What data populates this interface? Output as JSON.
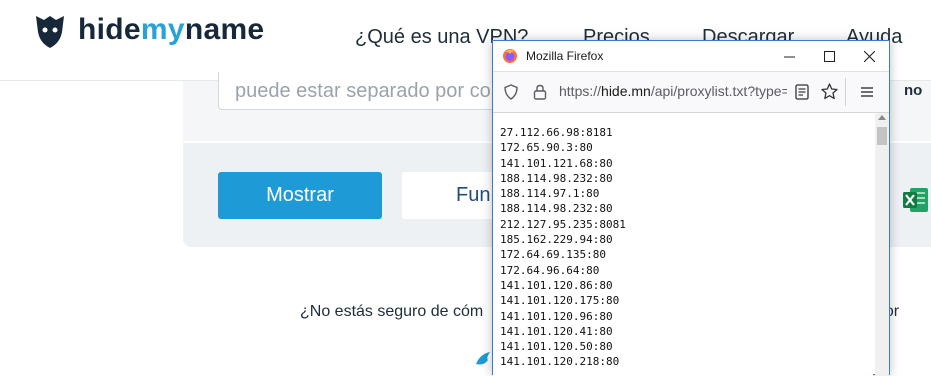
{
  "site": {
    "logo_prefix": "hide",
    "logo_accent": "my",
    "logo_suffix": "name",
    "nav": [
      "¿Qué es una VPN?",
      "Precios",
      "Descargar",
      "Ayuda"
    ],
    "search_placeholder": "puede estar separado por co",
    "right_label": "no",
    "show_button": "Mostrar",
    "fun_button": "Fun",
    "help_text": "¿No estás seguro de cóm",
    "help_text_right": "dor"
  },
  "firefox": {
    "title": "Mozilla Firefox",
    "url_prefix": "https://",
    "url_host": "hide.mn",
    "url_path": "/api/proxylist.txt?type=",
    "proxies": [
      "27.112.66.98:8181",
      "172.65.90.3:80",
      "141.101.121.68:80",
      "188.114.98.232:80",
      "188.114.97.1:80",
      "188.114.98.232:80",
      "212.127.95.235:8081",
      "185.162.229.94:80",
      "172.64.69.135:80",
      "172.64.96.64:80",
      "141.101.120.86:80",
      "141.101.120.175:80",
      "141.101.120.96:80",
      "141.101.120.41:80",
      "141.101.120.50:80",
      "141.101.120.218:80"
    ]
  },
  "colors": {
    "brand_dark": "#16283a",
    "brand_accent": "#27a3d9",
    "button_blue": "#1e9ad6",
    "excel_green": "#21a366"
  },
  "icons": [
    "logo-mark-icon",
    "firefox-logo-icon",
    "minimize-icon",
    "maximize-icon",
    "close-icon",
    "shield-icon",
    "lock-icon",
    "reader-view-icon",
    "bookmark-star-icon",
    "hamburger-menu-icon",
    "excel-icon",
    "bird-icon"
  ]
}
